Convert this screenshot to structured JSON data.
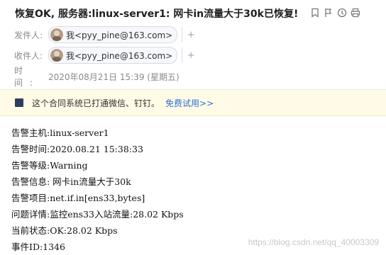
{
  "subject": "恢复OK, 服务器:linux-server1: 网卡in流量大于30k已恢复!",
  "actions": [
    "bookmark-icon",
    "flag-icon",
    "clock-icon",
    "print-icon"
  ],
  "sender": {
    "label": "发件人:",
    "contact": "我<pyy_pine@163.com>",
    "add": "+"
  },
  "recipient": {
    "label": "收件人:",
    "contact": "我<pyy_pine@163.com>",
    "add": "+"
  },
  "time": {
    "label": "时间:",
    "value": "2020年08月21日 15:39 (星期五)"
  },
  "notice": {
    "text": "这个合同系统已打通微信、钉钉。",
    "link": "免费试用>>"
  },
  "body": [
    "告警主机:linux-server1",
    "告警时间:2020.08.21 15:38:33",
    "告警等级:Warning",
    "告警信息: 网卡in流量大于30k",
    "告警项目:net.if.in[ens33,bytes]",
    "问题详情:监控ens33入站流量:28.02 Kbps",
    "当前状态:OK:28.02 Kbps",
    "事件ID:1346"
  ],
  "watermark": "https://blog.csdn.net/qq_40003309",
  "colors": {
    "link": "#2f6fd6",
    "notice_bg": "#fffbe6"
  }
}
